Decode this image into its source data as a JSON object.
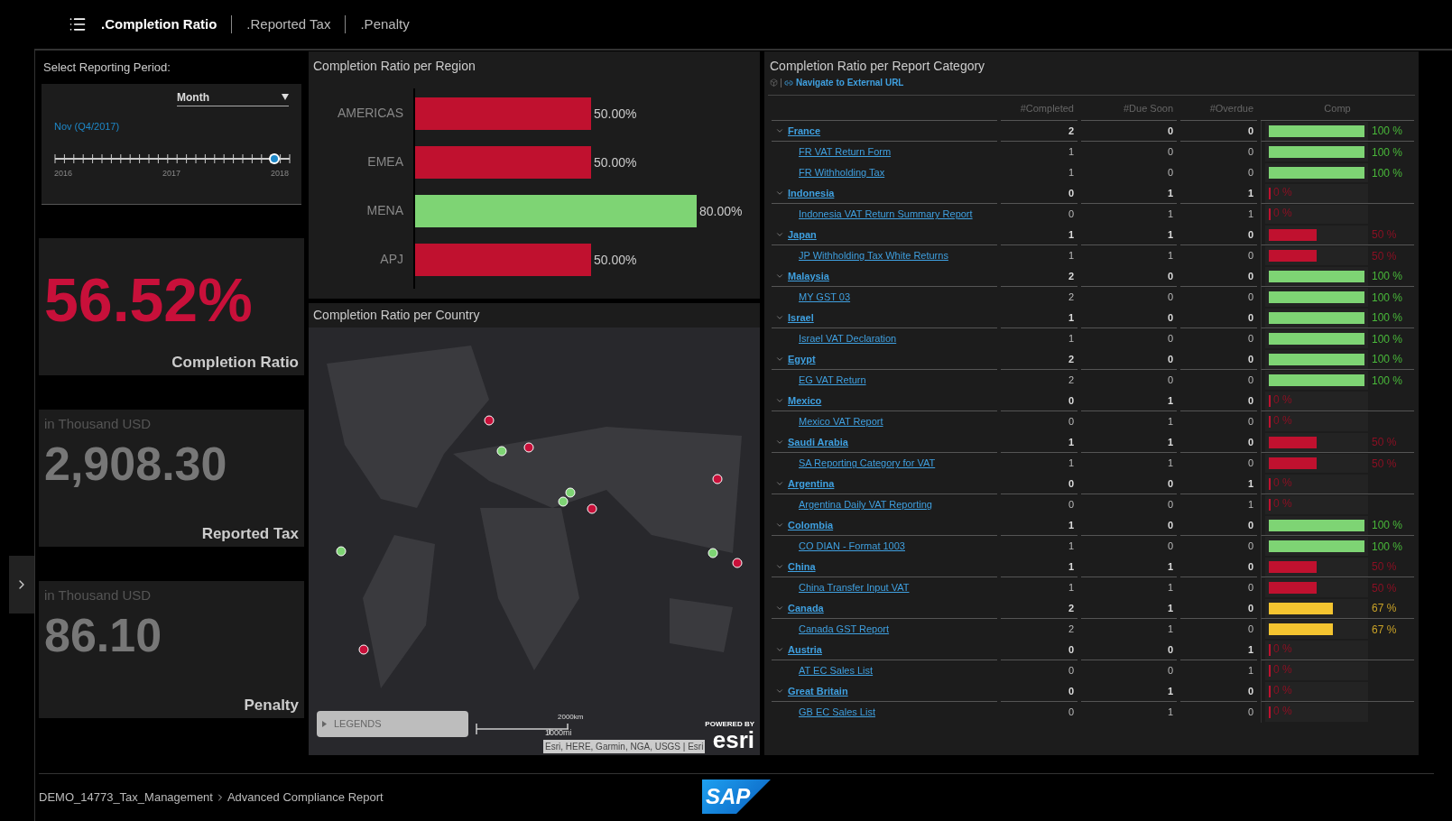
{
  "tabs": [
    {
      "label": ".Completion Ratio",
      "selected": true
    },
    {
      "label": ".Reported Tax",
      "selected": false
    },
    {
      "label": ".Penalty",
      "selected": false
    }
  ],
  "period": {
    "title": "Select Reporting Period:",
    "granularity": "Month",
    "current": "Nov (Q4/2017)",
    "level": 0.93,
    "years": [
      "2016",
      "2017",
      "2018"
    ]
  },
  "kpis": [
    {
      "value": "56.52%",
      "label": "Completion Ratio",
      "alert": true
    },
    {
      "unit": "in Thousand USD",
      "value": "2,908.30",
      "label": "Reported Tax",
      "alert": false
    },
    {
      "unit": "in Thousand USD",
      "value": "86.10",
      "label": "Penalty",
      "alert": false
    }
  ],
  "region_panel": {
    "title": "Completion Ratio per Region",
    "chart_data": {
      "type": "bar",
      "orientation": "horizontal",
      "categories": [
        "AMERICAS",
        "EMEA",
        "MENA",
        "APJ"
      ],
      "values": [
        50,
        50,
        80,
        50
      ],
      "data_labels": true,
      "value_labels": [
        "50.00%",
        "50.00%",
        "80.00%",
        "50.00%"
      ]
    }
  },
  "country_panel": {
    "title": "Completion Ratio per Country",
    "legends": "LEGENDS",
    "scale_km": "2000km",
    "scale_mi": "1000mi",
    "attribution": "Esri, HERE, Garmin, NGA, USGS | Esri",
    "powered_by": "POWERED BY",
    "esri": "esri"
  },
  "category_panel": {
    "title": "Completion Ratio per Report Category",
    "link": "Navigate to External URL",
    "columns": [
      "#Completed",
      "#Due Soon",
      "#Overdue",
      "Comp"
    ],
    "rows": [
      {
        "name": "France",
        "expanded": true,
        "completed": "2",
        "due_soon": "0",
        "overdue": "0",
        "level": 1,
        "ratio": "100 %",
        "children": [
          {
            "name": "FR VAT Return Form",
            "completed": "1",
            "due_soon": "0",
            "overdue": "0",
            "level": 1,
            "ratio": "100 %"
          },
          {
            "name": "FR Withholding Tax",
            "completed": "1",
            "due_soon": "0",
            "overdue": "0",
            "level": 1,
            "ratio": "100 %"
          }
        ]
      },
      {
        "name": "Indonesia",
        "expanded": true,
        "completed": "0",
        "due_soon": "1",
        "overdue": "1",
        "level": 0,
        "ratio": "0 %",
        "children": [
          {
            "name": "Indonesia VAT Return Summary Report",
            "completed": "0",
            "due_soon": "1",
            "overdue": "1",
            "level": 0,
            "ratio": "0 %"
          }
        ]
      },
      {
        "name": "Japan",
        "expanded": true,
        "completed": "1",
        "due_soon": "1",
        "overdue": "0",
        "level": 0.5,
        "ratio": "50 %",
        "children": [
          {
            "name": "JP Withholding Tax White Returns",
            "completed": "1",
            "due_soon": "1",
            "overdue": "0",
            "level": 0.5,
            "ratio": "50 %"
          }
        ]
      },
      {
        "name": "Malaysia",
        "expanded": true,
        "completed": "2",
        "due_soon": "0",
        "overdue": "0",
        "level": 1,
        "ratio": "100 %",
        "children": [
          {
            "name": "MY GST 03",
            "completed": "2",
            "due_soon": "0",
            "overdue": "0",
            "level": 1,
            "ratio": "100 %"
          }
        ]
      },
      {
        "name": "Israel",
        "expanded": true,
        "completed": "1",
        "due_soon": "0",
        "overdue": "0",
        "level": 1,
        "ratio": "100 %",
        "children": [
          {
            "name": "Israel VAT Declaration",
            "completed": "1",
            "due_soon": "0",
            "overdue": "0",
            "level": 1,
            "ratio": "100 %"
          }
        ]
      },
      {
        "name": "Egypt",
        "expanded": true,
        "completed": "2",
        "due_soon": "0",
        "overdue": "0",
        "level": 1,
        "ratio": "100 %",
        "children": [
          {
            "name": "EG VAT Return",
            "completed": "2",
            "due_soon": "0",
            "overdue": "0",
            "level": 1,
            "ratio": "100 %"
          }
        ]
      },
      {
        "name": "Mexico",
        "expanded": true,
        "completed": "0",
        "due_soon": "1",
        "overdue": "0",
        "level": 0,
        "ratio": "0 %",
        "children": [
          {
            "name": "Mexico VAT Report",
            "completed": "0",
            "due_soon": "1",
            "overdue": "0",
            "level": 0,
            "ratio": "0 %"
          }
        ]
      },
      {
        "name": "Saudi Arabia",
        "expanded": true,
        "completed": "1",
        "due_soon": "1",
        "overdue": "0",
        "level": 0.5,
        "ratio": "50 %",
        "children": [
          {
            "name": "SA Reporting Category for VAT",
            "completed": "1",
            "due_soon": "1",
            "overdue": "0",
            "level": 0.5,
            "ratio": "50 %"
          }
        ]
      },
      {
        "name": "Argentina",
        "expanded": true,
        "completed": "0",
        "due_soon": "0",
        "overdue": "1",
        "level": 0,
        "ratio": "0 %",
        "children": [
          {
            "name": "Argentina Daily VAT Reporting",
            "completed": "0",
            "due_soon": "0",
            "overdue": "1",
            "level": 0,
            "ratio": "0 %"
          }
        ]
      },
      {
        "name": "Colombia",
        "expanded": true,
        "completed": "1",
        "due_soon": "0",
        "overdue": "0",
        "level": 1,
        "ratio": "100 %",
        "children": [
          {
            "name": "CO DIAN - Format 1003",
            "completed": "1",
            "due_soon": "0",
            "overdue": "0",
            "level": 1,
            "ratio": "100 %"
          }
        ]
      },
      {
        "name": "China",
        "expanded": true,
        "completed": "1",
        "due_soon": "1",
        "overdue": "0",
        "level": 0.5,
        "ratio": "50 %",
        "children": [
          {
            "name": "China Transfer Input VAT",
            "completed": "1",
            "due_soon": "1",
            "overdue": "0",
            "level": 0.5,
            "ratio": "50 %"
          }
        ]
      },
      {
        "name": "Canada",
        "expanded": true,
        "completed": "2",
        "due_soon": "1",
        "overdue": "0",
        "level": 0.67,
        "ratio": "67 %",
        "children": [
          {
            "name": "Canada GST Report",
            "completed": "2",
            "due_soon": "1",
            "overdue": "0",
            "level": 0.67,
            "ratio": "67 %"
          }
        ]
      },
      {
        "name": "Austria",
        "expanded": true,
        "completed": "0",
        "due_soon": "0",
        "overdue": "1",
        "level": 0,
        "ratio": "0 %",
        "children": [
          {
            "name": "AT EC Sales List",
            "completed": "0",
            "due_soon": "0",
            "overdue": "1",
            "level": 0,
            "ratio": "0 %"
          }
        ]
      },
      {
        "name": "Great Britain",
        "expanded": true,
        "completed": "0",
        "due_soon": "1",
        "overdue": "0",
        "level": 0,
        "ratio": "0 %",
        "children": [
          {
            "name": "GB EC Sales List",
            "completed": "0",
            "due_soon": "1",
            "overdue": "0",
            "level": 0,
            "ratio": "0 %"
          }
        ]
      }
    ]
  },
  "breadcrumb": [
    "DEMO_14773_Tax_Management",
    "Advanced Compliance Report"
  ],
  "logo": "SAP"
}
